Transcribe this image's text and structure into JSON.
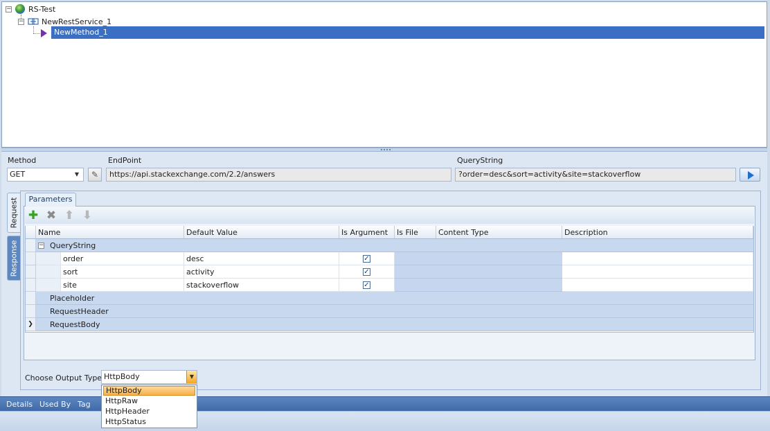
{
  "tree": {
    "root": "RS-Test",
    "service": "NewRestService_1",
    "method": "NewMethod_1"
  },
  "request_form": {
    "method_label": "Method",
    "method_value": "GET",
    "endpoint_label": "EndPoint",
    "endpoint_value": "https://api.stackexchange.com/2.2/answers",
    "querystring_label": "QueryString",
    "querystring_value": "?order=desc&sort=activity&site=stackoverflow"
  },
  "side_tabs": {
    "request": "Request",
    "response": "Response"
  },
  "parameters_tab": "Parameters",
  "toolbar_icons": [
    "add-icon",
    "delete-icon",
    "move-up-icon",
    "move-down-icon"
  ],
  "grid": {
    "columns": [
      "Name",
      "Default Value",
      "Is Argument",
      "Is File",
      "Content Type",
      "Description"
    ],
    "groups": [
      "QueryString",
      "Placeholder",
      "RequestHeader",
      "RequestBody"
    ],
    "querystring_rows": [
      {
        "name": "order",
        "default": "desc",
        "is_argument": true
      },
      {
        "name": "sort",
        "default": "activity",
        "is_argument": true
      },
      {
        "name": "site",
        "default": "stackoverflow",
        "is_argument": true
      }
    ]
  },
  "output": {
    "label": "Choose Output Type",
    "selected": "HttpBody",
    "options": [
      "HttpBody",
      "HttpRaw",
      "HttpHeader",
      "HttpStatus"
    ]
  },
  "bottom_tabs": [
    "Details",
    "Used By",
    "Tag"
  ],
  "colors": {
    "selection": "#3a6fc4",
    "tab_bar": "#4a76b4",
    "method_icon": "#7b2fb0"
  }
}
